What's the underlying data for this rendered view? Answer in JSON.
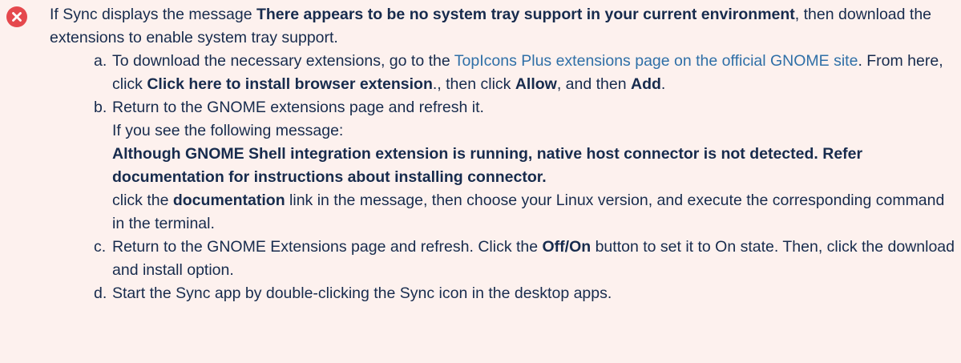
{
  "icon": {
    "name": "error-icon",
    "color": "#e5484d"
  },
  "intro": {
    "prefix": "If Sync displays the message ",
    "bold": "There appears to be no system tray support in your current environment",
    "suffix": ", then download the extensions to enable system tray support."
  },
  "steps": [
    {
      "marker": "a.",
      "t1": "To download the necessary extensions, go to the ",
      "link": "TopIcons Plus extensions page on the official GNOME site",
      "t2": ". From here, click ",
      "b1": "Click here to install browser extension",
      "t3": "., then click ",
      "b2": "Allow",
      "t4": ", and then ",
      "b3": "Add",
      "t5": "."
    },
    {
      "marker": "b.",
      "line1": "Return to the GNOME extensions page and refresh it.",
      "line2": "If you see the following message:",
      "msg": "Although GNOME Shell integration extension is running, native host connector is not detected. Refer documentation for instructions about installing connector.",
      "t1": "click the ",
      "b1": "documentation",
      "t2": " link in the message, then choose your Linux version, and execute the corresponding command in the terminal."
    },
    {
      "marker": "c.",
      "t1": "Return to the GNOME Extensions page and refresh. Click the ",
      "b1": "Off/On",
      "t2": " button to set it to On state. Then, click the download and install option."
    },
    {
      "marker": "d.",
      "t1": "Start the Sync app by double-clicking the Sync icon in the desktop apps."
    }
  ]
}
